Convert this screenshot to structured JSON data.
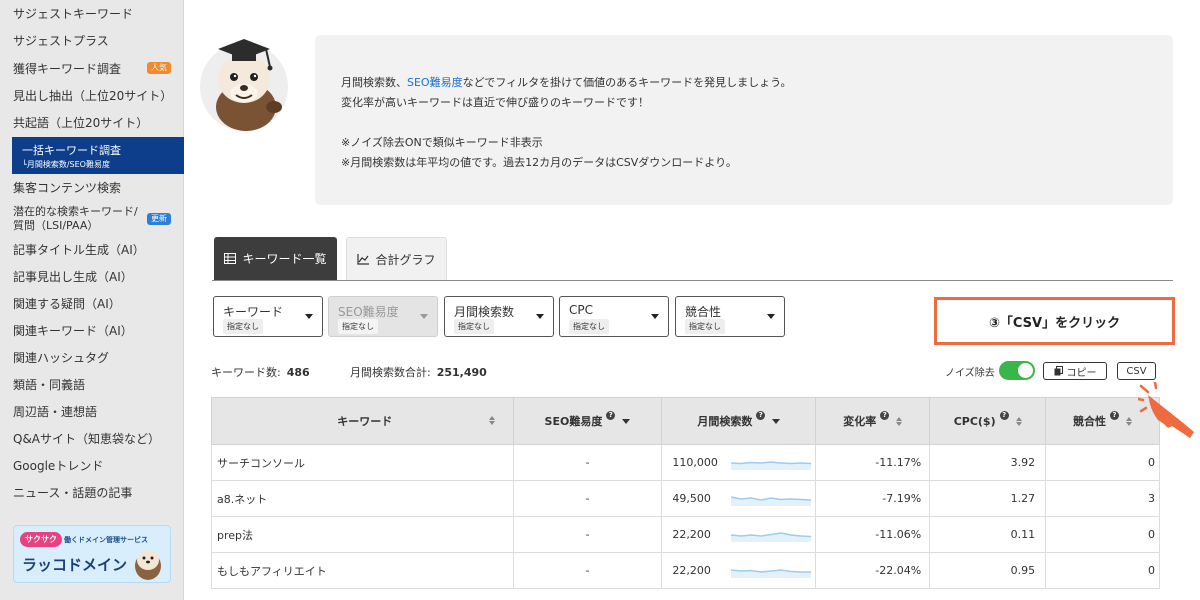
{
  "sidebar": {
    "items": [
      {
        "label": "サジェストキーワード"
      },
      {
        "label": "サジェストプラス"
      },
      {
        "label": "獲得キーワード調査",
        "badge": "人気"
      },
      {
        "label": "見出し抽出（上位20サイト）"
      },
      {
        "label": "共起語（上位20サイト）"
      },
      {
        "label": "一括キーワード調査",
        "sub": "└月間検索数/SEO難易度",
        "active": true
      },
      {
        "label": "集客コンテンツ検索"
      },
      {
        "label": "潜在的な検索キーワード/\n質問（LSI/PAA）",
        "badge": "更新"
      },
      {
        "label": "記事タイトル生成（AI）"
      },
      {
        "label": "記事見出し生成（AI）"
      },
      {
        "label": "関連する疑問（AI）"
      },
      {
        "label": "関連キーワード（AI）"
      },
      {
        "label": "関連ハッシュタグ"
      },
      {
        "label": "類語・同義語"
      },
      {
        "label": "周辺語・連想語"
      },
      {
        "label": "Q&Aサイト（知恵袋など）"
      },
      {
        "label": "Googleトレンド"
      },
      {
        "label": "ニュース・話題の記事"
      }
    ],
    "banner": {
      "tag": "サクサク",
      "sub": "働くドメイン管理サービス",
      "title": "ラッコドメイン"
    }
  },
  "info": {
    "line1_a": "月間検索数、",
    "line1_link": "SEO難易度",
    "line1_b": "などでフィルタを掛けて価値のあるキーワードを発見しましょう。",
    "line2": "変化率が高いキーワードは直近で伸び盛りのキーワードです！",
    "line3": "※ノイズ除去ONで類似キーワード非表示",
    "line4": "※月間検索数は年平均の値です。過去12カ月のデータはCSVダウンロードより。"
  },
  "tabs": {
    "list": "キーワード一覧",
    "graph": "合計グラフ"
  },
  "filters": [
    {
      "label": "キーワード",
      "sub": "指定なし",
      "disabled": false
    },
    {
      "label": "SEO難易度",
      "sub": "指定なし",
      "disabled": true
    },
    {
      "label": "月間検索数",
      "sub": "指定なし",
      "disabled": false
    },
    {
      "label": "CPC",
      "sub": "指定なし",
      "disabled": false
    },
    {
      "label": "競合性",
      "sub": "指定なし",
      "disabled": false
    }
  ],
  "callout": "③「CSV」をクリック",
  "stats": {
    "kw_count_label": "キーワード数:",
    "kw_count": "486",
    "total_label": "月間検索数合計:",
    "total": "251,490"
  },
  "toolbar": {
    "noise_label": "ノイズ除去",
    "noise_on": true,
    "copy_label": "コピー",
    "csv_label": "CSV"
  },
  "table": {
    "headers": {
      "keyword": "キーワード",
      "seo": "SEO難易度",
      "volume": "月間検索数",
      "change": "変化率",
      "cpc": "CPC($)",
      "comp": "競合性"
    },
    "rows": [
      {
        "keyword": "サーチコンソール",
        "seo": "-",
        "volume": "110,000",
        "change": "-11.17%",
        "cpc": "3.92",
        "comp": "0"
      },
      {
        "keyword": "a8.ネット",
        "seo": "-",
        "volume": "49,500",
        "change": "-7.19%",
        "cpc": "1.27",
        "comp": "3"
      },
      {
        "keyword": "prep法",
        "seo": "-",
        "volume": "22,200",
        "change": "-11.06%",
        "cpc": "0.11",
        "comp": "0"
      },
      {
        "keyword": "もしもアフィリエイト",
        "seo": "-",
        "volume": "22,200",
        "change": "-22.04%",
        "cpc": "0.95",
        "comp": "0"
      }
    ]
  },
  "colors": {
    "accent": "#0d3e8c",
    "callout_border": "#ef6a3e",
    "toggle_on": "#3ab54a",
    "negative": "#d02a2a",
    "spark": "#9fcbed"
  }
}
